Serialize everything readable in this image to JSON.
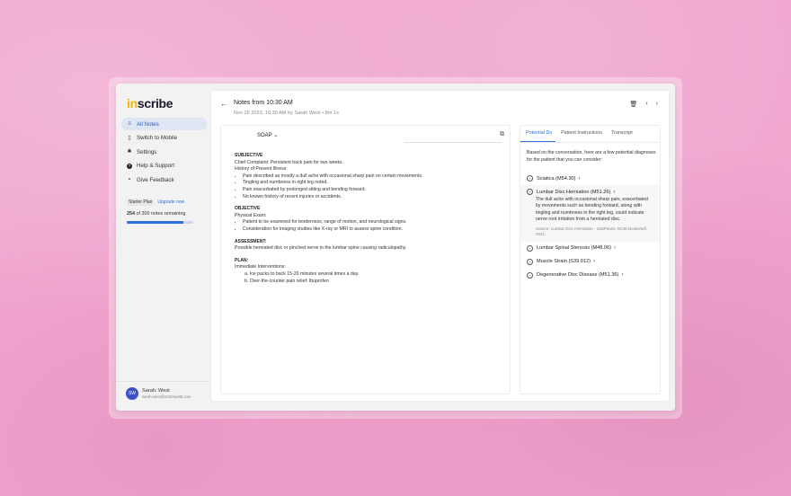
{
  "app": {
    "logo_prefix": "in",
    "logo_rest": "scribe"
  },
  "sidebar": {
    "items": [
      {
        "label": "All Notes",
        "icon": "list-icon",
        "glyph": "≡"
      },
      {
        "label": "Switch to Mobile",
        "icon": "phone-icon",
        "glyph": "▯"
      },
      {
        "label": "Settings",
        "icon": "gear-icon",
        "glyph": "✱"
      },
      {
        "label": "Help & Support",
        "icon": "help-icon",
        "glyph": "?"
      },
      {
        "label": "Give Feedback",
        "icon": "feedback-icon",
        "glyph": "▪"
      }
    ],
    "plan": {
      "badge": "Starter Plan",
      "upgrade": "Upgrade now",
      "used": "254",
      "count_text": "of 300 notes remaining",
      "progress_fraction": 0.85
    },
    "user": {
      "initials": "SW",
      "name": "Sarah. West",
      "email": "sarah.west@starthealth.com"
    }
  },
  "header": {
    "title": "Notes from 10:30 AM",
    "subtitle": "Nov 26 2023, 10:30 AM by Sarah West • 8m 1s"
  },
  "notes": {
    "format_label": "SOAP",
    "subjective": {
      "heading": "SUBJECTIVE",
      "chief": "Chief Complaint: Persistent back pain for two weeks.",
      "history_label": "History of Present Illness:",
      "bullets": [
        "Pain described as mostly a dull ache with occasional sharp pain on certain movements.",
        "Tingling and numbness in right leg noted.",
        "Pain exacerbated by prolonged sitting and bending forward.",
        "No known history of recent injuries or accidents."
      ]
    },
    "objective": {
      "heading": "OBJECTIVE",
      "exam_label": "Physical Exam:",
      "bullets": [
        "Patient to be examined for tenderness, range of motion, and neurological signs.",
        "Consideration for imaging studies like X-ray or MRI to assess spine condition."
      ]
    },
    "assessment": {
      "heading": "ASSESSMENT:",
      "text": "Possible herniated disc or pinched nerve in the lumbar spine causing radiculopathy."
    },
    "plan": {
      "heading": "PLAN:",
      "label": "Immediate Interventions:",
      "items": [
        "a.  Ice packs to back 15-20 minutes several times a day.",
        "b.  Over-the-counter pain relief: Ibuprofen"
      ]
    }
  },
  "dx_panel": {
    "tabs": [
      "Potential Dx",
      "Patient Instructions",
      "Transcript"
    ],
    "intro": "Based on the conversation, here are a few potential diagnoses for the patient that you can consider:",
    "items": [
      {
        "label": "Sciatica (M54.30)"
      },
      {
        "label": "Lumbar Disc Herniation (M51.26)",
        "detail": "The dull ache with occasional sharp pain, exacerbated by movements such as bending forward, along with tingling and numbness in the right leg, could indicate nerve root irritation from a herniated disc.",
        "source": "Source: Lumbar Disc Herniation - StatPearls, NCBI Bookshelf, 2021."
      },
      {
        "label": "Lumbar Spinal Stenosis (M48.06)"
      },
      {
        "label": "Muscle Strain (S39.012)"
      },
      {
        "label": "Degenerative Disc Disease (M51.36)"
      }
    ]
  }
}
